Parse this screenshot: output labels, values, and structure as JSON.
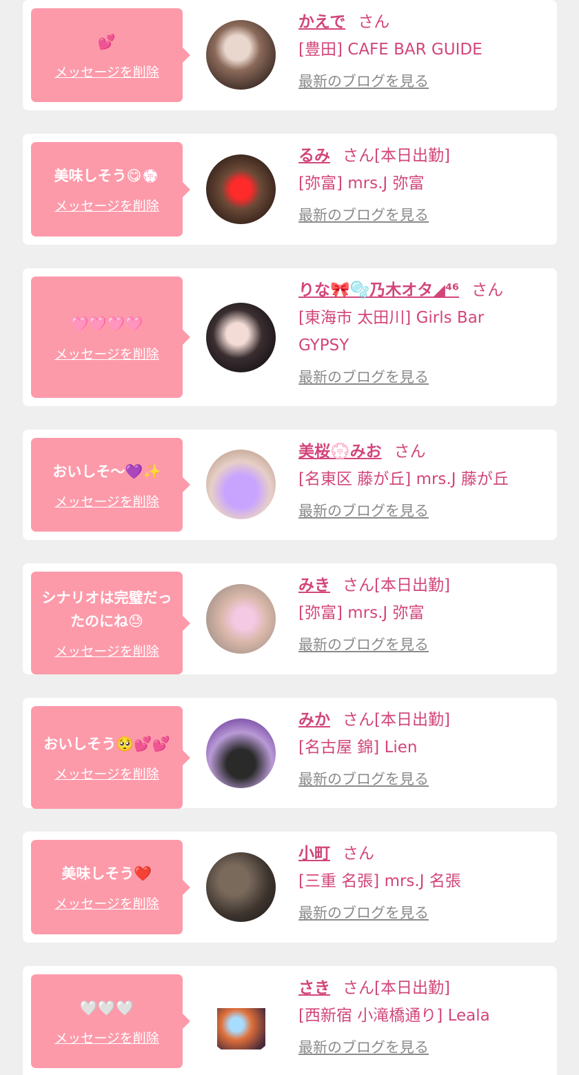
{
  "colors": {
    "background": "#efefef",
    "card": "#ffffff",
    "bubble": "#fd9aaa",
    "accent": "#d2457a",
    "muted": "#8a8a8a"
  },
  "labels": {
    "delete": "メッセージを削除",
    "blog": "最新のブログを見る"
  },
  "items": [
    {
      "message": "💕",
      "name": "かえで",
      "suffix": "さん",
      "shop": "[豊田] CAFE BAR GUIDE",
      "avatar_icon": "photo-icon"
    },
    {
      "message": "美味しそう😋💮",
      "name": "るみ",
      "suffix": "さん[本日出勤]",
      "shop": "[弥富] mrs.J 弥富",
      "avatar_icon": "photo-icon"
    },
    {
      "message": "🩷🩷🩷🩷",
      "name": "りな🎀🫧乃木オタ◢⁴⁶",
      "suffix": "さん",
      "shop": "[東海市 太田川] Girls Bar GYPSY",
      "avatar_icon": "photo-icon"
    },
    {
      "message": "おいしそ〜💜✨",
      "name": "美桜💮みお",
      "suffix": "さん",
      "shop": "[名東区 藤が丘] mrs.J 藤が丘",
      "avatar_icon": "photo-icon"
    },
    {
      "message": "シナリオは完璧だったのにね😓",
      "name": "みき",
      "suffix": "さん[本日出勤]",
      "shop": "[弥富] mrs.J 弥富",
      "avatar_icon": "photo-icon"
    },
    {
      "message": "おいしそう🥺💕💕",
      "name": "みか",
      "suffix": "さん[本日出勤]",
      "shop": "[名古屋 錦] Lien",
      "avatar_icon": "photo-icon"
    },
    {
      "message": "美味しそう❤️",
      "name": "小町",
      "suffix": "さん",
      "shop": "[三重 名張] mrs.J 名張",
      "avatar_icon": "photo-icon"
    },
    {
      "message": "🤍🤍🤍",
      "name": "さき",
      "suffix": "さん[本日出勤]",
      "shop": "[西新宿 小滝橋通り] Leala",
      "avatar_icon": "photo-icon"
    }
  ]
}
